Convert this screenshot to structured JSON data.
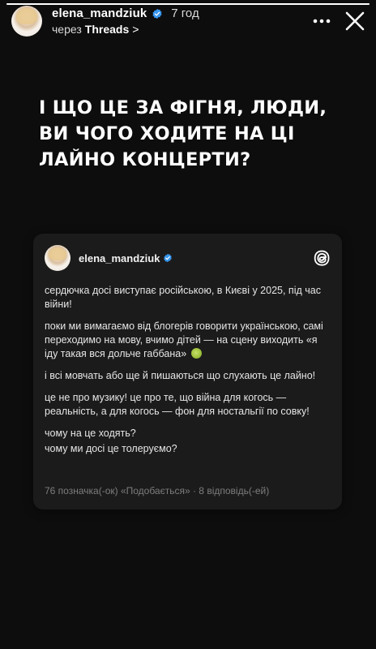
{
  "story": {
    "progress": 1.0,
    "username": "elena_mandziuk",
    "time_ago": "7 год",
    "via_prefix": "через",
    "via_app": "Threads",
    "via_chevron": ">"
  },
  "headline": {
    "lines": [
      "І ЩО ЦЕ ЗА ФІГНЯ, ЛЮДИ,",
      "ВИ ЧОГО ХОДИТЕ НА ЦІ",
      "ЛАЙНО КОНЦЕРТИ?"
    ]
  },
  "card": {
    "username": "elena_mandziuk",
    "paragraphs": [
      "сердючка досі виступає російською, в Києві у 2025, під час війни!",
      "поки ми вимагаємо від блогерів говорити українською, самі переходимо на мову, вчимо дітей — на сцену виходить «я іду такая вся дольче габбана»",
      "і всі мовчать або ще й пишаються що слухають це лайно!",
      "це не про музику! це про те, що війна для когось — реальність, а для когось — фон для ностальгії по совку!",
      "чому на це ходять?",
      "чому ми досі це толеруємо?"
    ],
    "footer": "76 позначка(-ок) «Подобається» · 8 відповідь(-ей)"
  },
  "icons": {
    "more": "more-horizontal-icon",
    "close": "close-icon",
    "verified": "verified-badge-icon",
    "threads": "threads-logo-icon"
  },
  "colors": {
    "background": "#0d0d0d",
    "card": "#1b1b1b",
    "verified": "#3897f0",
    "footer_text": "#7d7d7d"
  }
}
